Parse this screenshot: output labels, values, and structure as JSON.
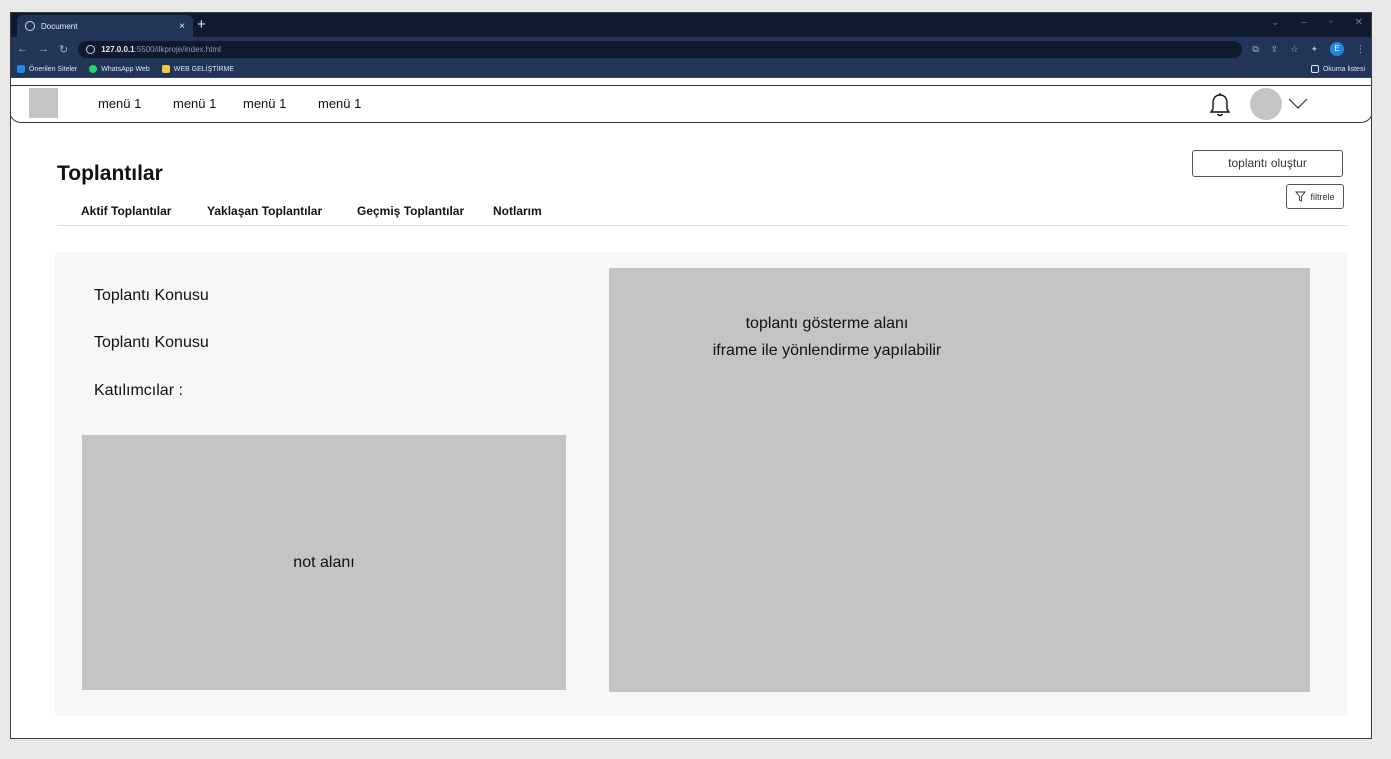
{
  "browser": {
    "tab_title": "Document",
    "tab_close": "×",
    "new_tab": "+",
    "url_host": "127.0.0.1",
    "url_rest": ":5500/ilkproje/index.html",
    "profile_letter": "E",
    "bookmarks": [
      {
        "label": "Önerilen Siteler",
        "color": "#1e88e5"
      },
      {
        "label": "WhatsApp Web",
        "color": "#25d366"
      },
      {
        "label": "WEB GELİŞTİRME",
        "color": "#f6c343"
      }
    ],
    "reading_list": "Okuma listesi"
  },
  "topnav": {
    "menu": [
      "menü 1",
      "menü 1",
      "menü 1",
      "menü 1"
    ]
  },
  "header": {
    "title": "Toplantılar",
    "create_button": "toplantı oluştur",
    "filter_button": "filtrele"
  },
  "tabs": [
    "Aktif Toplantılar",
    "Yaklaşan Toplantılar",
    "Geçmiş Toplantılar",
    "Notlarım"
  ],
  "details": {
    "subject_1": "Toplantı Konusu",
    "subject_2": "Toplantı Konusu",
    "participants": "Katılımcılar :",
    "notes_area": "not alanı"
  },
  "viewer": {
    "line1": "toplantı gösterme alanı",
    "line2": "iframe ile yönlendirme yapılabilir"
  },
  "colors": {
    "chrome_dark": "#0f1a2e",
    "chrome_mid": "#223559",
    "placeholder_gray": "#c4c4c4",
    "panel_bg": "#f7f7f7"
  }
}
